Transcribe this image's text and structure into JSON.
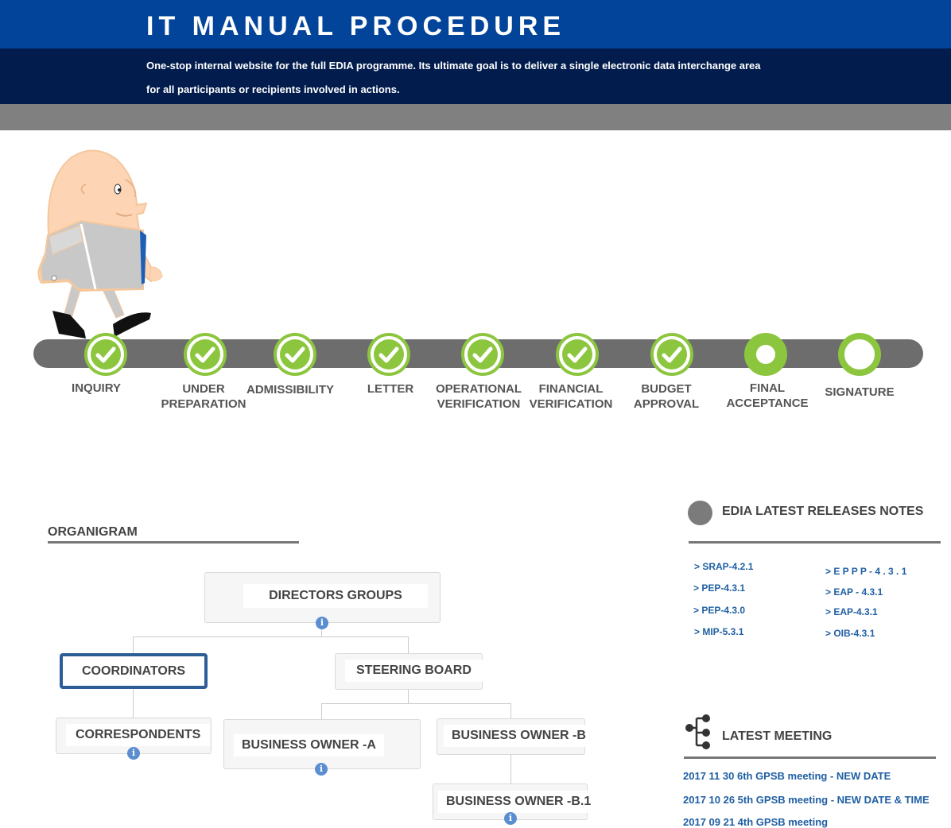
{
  "header": {
    "title": "IT MANUAL PROCEDURE",
    "subtitle_line1": "One-stop internal website for the full EDIA programme. Its ultimate goal is to deliver a single electronic data interchange area",
    "subtitle_line2": "for all participants or recipients involved in  actions."
  },
  "progress": {
    "steps": [
      {
        "label_line1": "INQUIRY",
        "label_line2": "",
        "status": "done"
      },
      {
        "label_line1": "UNDER",
        "label_line2": "PREPARATION",
        "status": "done"
      },
      {
        "label_line1": "ADMISSIBILITY",
        "label_line2": "",
        "status": "done"
      },
      {
        "label_line1": "LETTER",
        "label_line2": "",
        "status": "done"
      },
      {
        "label_line1": "OPERATIONAL",
        "label_line2": "VERIFICATION",
        "status": "done"
      },
      {
        "label_line1": "FINANCIAL",
        "label_line2": "VERIFICATION",
        "status": "done"
      },
      {
        "label_line1": "BUDGET",
        "label_line2": "APPROVAL",
        "status": "done"
      },
      {
        "label_line1": "FINAL",
        "label_line2": "ACCEPTANCE",
        "status": "current"
      },
      {
        "label_line1": "SIGNATURE",
        "label_line2": "",
        "status": "pending"
      }
    ],
    "colors": {
      "done": "#8cc63e",
      "track": "#6d6d6d"
    }
  },
  "organigram": {
    "title": "ORGANIGRAM",
    "nodes": {
      "directors": "DIRECTORS GROUPS",
      "coordinators": "COORDINATORS",
      "steering": "STEERING BOARD",
      "correspondents": "CORRESPONDENTS",
      "owner_a": "BUSINESS OWNER -A",
      "owner_b": "BUSINESS OWNER -B",
      "owner_b1": "BUSINESS OWNER -B.1"
    },
    "info_glyph": "i",
    "selected": "COORDINATORS"
  },
  "releases": {
    "title": "EDIA LATEST RELEASES NOTES",
    "left": [
      "> SRAP-4.2.1",
      "> PEP-4.3.1",
      "> PEP-4.3.0",
      "> MIP-5.3.1"
    ],
    "right": [
      "> E P P P - 4 . 3 . 1",
      "> EAP - 4.3.1",
      "> EAP-4.3.1",
      "> OIB-4.3.1"
    ]
  },
  "meeting": {
    "title": "LATEST MEETING",
    "items": [
      "2017 11 30 6th GPSB meeting - NEW DATE",
      "2017 10 26 5th GPSB meeting - NEW DATE & TIME",
      "2017 09 21 4th GPSB meeting"
    ]
  },
  "icons": [
    "check-icon",
    "info-icon",
    "hierarchy-icon",
    "circle-bullet-icon"
  ]
}
